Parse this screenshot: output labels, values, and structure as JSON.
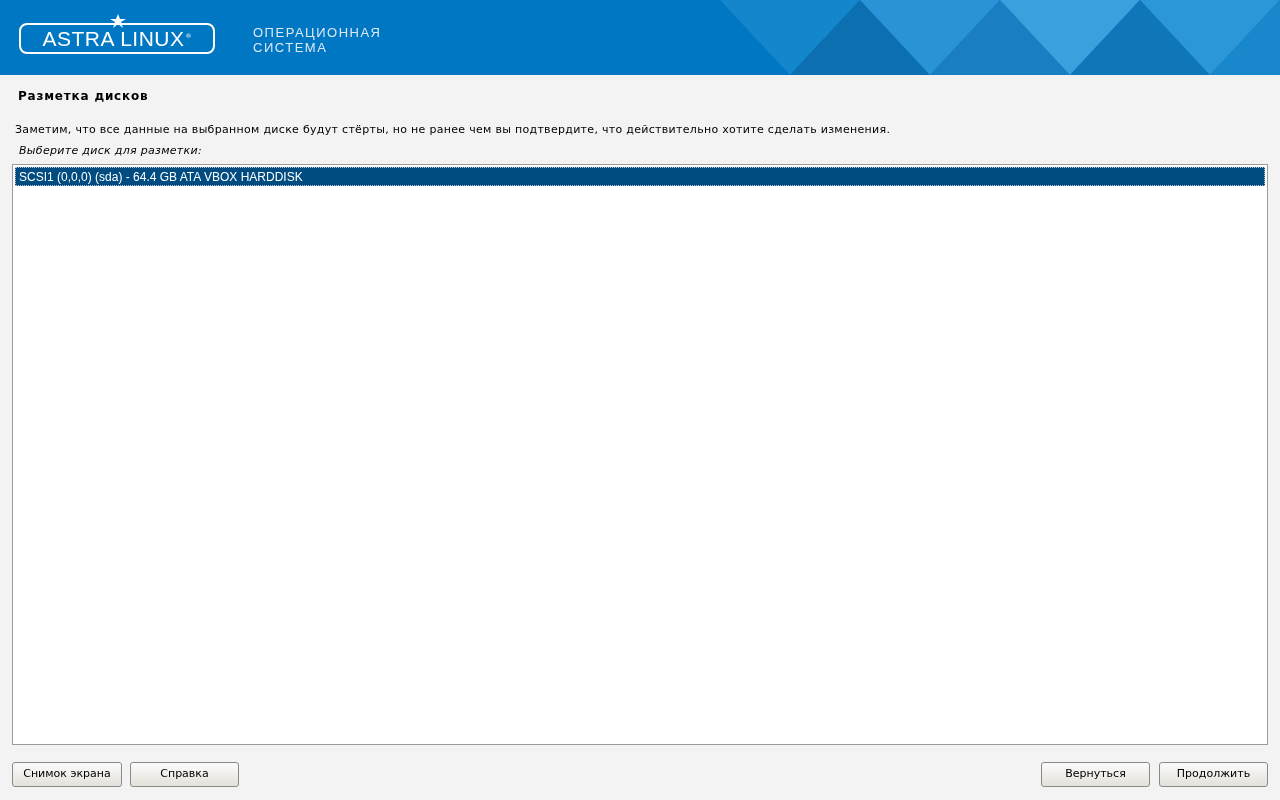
{
  "header": {
    "logo": "ASTRA LINUX",
    "logo_mark": "®",
    "tagline": [
      "ОПЕРАЦИОННАЯ",
      "СИСТЕМА"
    ]
  },
  "title": "Разметка дисков",
  "note": "Заметим, что все данные на выбранном диске будут стёрты, но не ранее чем вы подтвердите, что действительно хотите сделать изменения.",
  "prompt": "Выберите диск для разметки:",
  "disks": [
    {
      "label": "SCSI1 (0,0,0) (sda) - 64.4 GB ATA VBOX HARDDISK",
      "selected": true
    }
  ],
  "buttons_left": [
    "Снимок экрана",
    "Справка"
  ],
  "buttons_right": [
    "Вернуться",
    "Продолжить"
  ]
}
